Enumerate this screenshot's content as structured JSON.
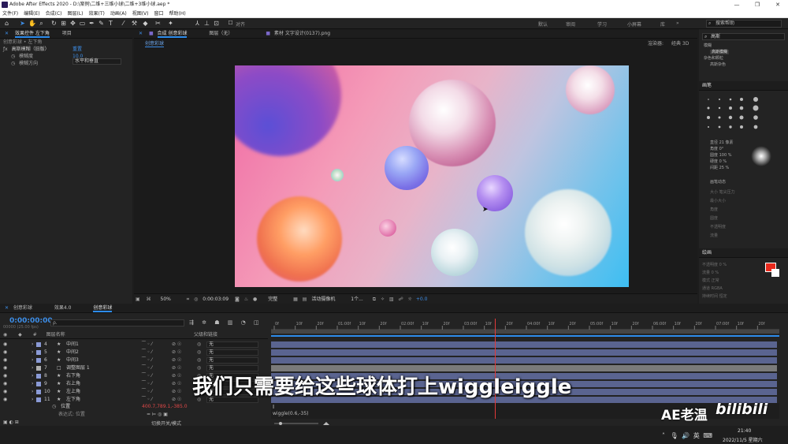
{
  "window": {
    "title": "Adobe After Effects 2020 - D:\\案例\\二维+三维小球\\二维+3维小球.aep *",
    "minimize": "—",
    "maximize": "❐",
    "close": "✕"
  },
  "menu": [
    "文件(F)",
    "编辑(E)",
    "合成(C)",
    "图层(L)",
    "效果(T)",
    "动画(A)",
    "视图(V)",
    "窗口",
    "帮助(H)"
  ],
  "toolbar": {
    "align_label": "对齐",
    "workspaces": [
      "默认",
      "审阅",
      "学习",
      "小屏幕",
      "库",
      "»"
    ],
    "help_search_placeholder": "搜索帮助"
  },
  "effect_controls": {
    "tabs": [
      "效果控件 左下角",
      "项目"
    ],
    "subtitle": "创意彩球 • 左下角",
    "effect_name": "高斯模糊（旧版）",
    "reset_label": "重置",
    "params": [
      {
        "name": "模糊度",
        "value": "10.0"
      },
      {
        "name": "模糊方向",
        "value": "水平和垂直"
      }
    ]
  },
  "composition": {
    "tabs": [
      "合成 创意彩球",
      "图层（无）",
      "素材 文字设计(0137).png"
    ],
    "comp_tab": "创意彩球",
    "renderer_label": "渲染器:",
    "renderer_value": "经典 3D",
    "footer": {
      "zoom": "50%",
      "timecode": "0:00:03:09",
      "resolution": "完整",
      "camera": "活动摄像机",
      "views": "1个...",
      "exposure": "+0.0"
    }
  },
  "right_panels": {
    "effects_title": "画笔",
    "effects_search": "高斯",
    "tree_items": [
      "模糊",
      "高斯模糊",
      "杂色和颗粒",
      "高斯杂色"
    ],
    "brush_params": [
      {
        "name": "直径",
        "value": "21 像素"
      },
      {
        "name": "角度",
        "value": "0°"
      },
      {
        "name": "圆度",
        "value": "100 %"
      },
      {
        "name": "硬度",
        "value": "0 %"
      },
      {
        "name": "间距",
        "value": "25 %"
      }
    ],
    "brush_dynamics": "画笔动态",
    "dyn_items": [
      "大小",
      "最小大小",
      "角度",
      "圆度",
      "不透明度",
      "流量"
    ],
    "dyn_value": "笔尖压力",
    "paint_title": "绘画",
    "paint_params": [
      {
        "name": "不透明度",
        "value": "0 %"
      },
      {
        "name": "流量",
        "value": "0 %"
      },
      {
        "name": "模式",
        "value": "正常"
      },
      {
        "name": "通道",
        "value": "RGBA"
      },
      {
        "name": "持续时间",
        "value": "恒定"
      }
    ],
    "fg_color": "#e8291c",
    "bg_color": "#ffffff"
  },
  "timeline": {
    "tabs": [
      "创意彩球",
      "效果4.0",
      "创意彩球"
    ],
    "timecode": "0:00:00:00",
    "timecode_sub": "00000 (25.00 fps)",
    "search_placeholder": "ρ.",
    "col_name": "图层名称",
    "col_parent": "父级和链接",
    "layers": [
      {
        "num": "4",
        "name": "中间1",
        "color": "#8a9ad6",
        "icon": "★",
        "parent": "无"
      },
      {
        "num": "5",
        "name": "中间2",
        "color": "#8a9ad6",
        "icon": "★",
        "parent": "无"
      },
      {
        "num": "6",
        "name": "中间3",
        "color": "#8a9ad6",
        "icon": "★",
        "parent": "无"
      },
      {
        "num": "7",
        "name": "调整图层 1",
        "color": "#b0b0b0",
        "icon": "□",
        "parent": "无"
      },
      {
        "num": "8",
        "name": "右下角",
        "color": "#8a9ad6",
        "icon": "★",
        "parent": "无"
      },
      {
        "num": "9",
        "name": "右上角",
        "color": "#8a9ad6",
        "icon": "★",
        "parent": "无"
      },
      {
        "num": "10",
        "name": "左上角",
        "color": "#8a9ad6",
        "icon": "★",
        "parent": "无"
      },
      {
        "num": "11",
        "name": "左下角",
        "color": "#8a9ad6",
        "icon": "★",
        "parent": "无"
      }
    ],
    "prop_name": "位置",
    "prop_value": "400.7,789.1,-385.0",
    "expr_label": "表达式: 位置",
    "expr_text": "wiggle(0.6,-35)",
    "ruler": [
      "0f",
      "10f",
      "20f",
      "01:00f",
      "10f",
      "20f",
      "02:00f",
      "10f",
      "20f",
      "03:00f",
      "10f",
      "20f",
      "04:00f",
      "10f",
      "20f",
      "05:00f",
      "10f",
      "20f",
      "06:00f",
      "10f",
      "20f",
      "07:00f",
      "10f",
      "20f"
    ],
    "switch_mode": "切换开关/模式",
    "playhead_fraction": 0.44
  },
  "subtitle": "我们只需要给这些球体打上wiggleiggle",
  "watermark": {
    "text1": "AE老温",
    "text2": "bilibili"
  },
  "tray": {
    "time": "21:40",
    "date": "2022/11/5 星期六",
    "ime": "英"
  }
}
